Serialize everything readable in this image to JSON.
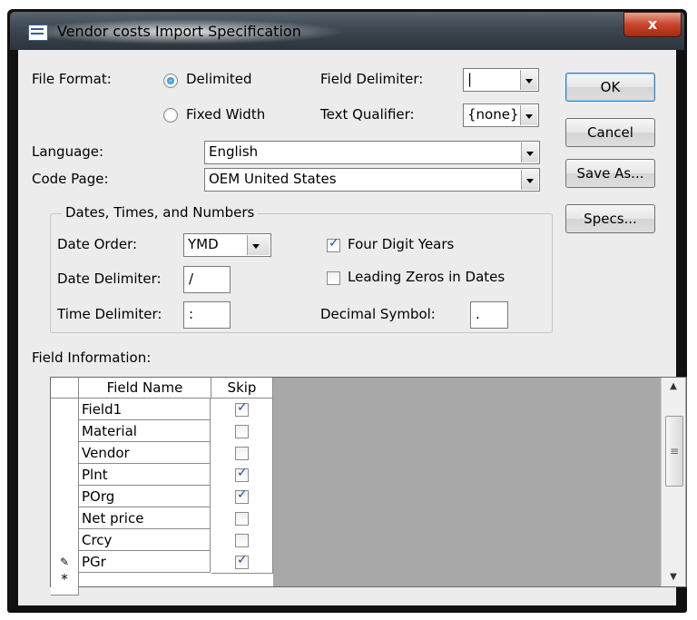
{
  "window": {
    "title": "Vendor costs Import Specification",
    "close_label": "x"
  },
  "file_format": {
    "label": "File Format:",
    "delimited_label": "Delimited",
    "fixed_label": "Fixed Width",
    "selected": "Delimited"
  },
  "field_delimiter": {
    "label": "Field Delimiter:",
    "value": "|"
  },
  "text_qualifier": {
    "label": "Text Qualifier:",
    "value": "{none}"
  },
  "language": {
    "label": "Language:",
    "value": "English"
  },
  "code_page": {
    "label": "Code Page:",
    "value": "OEM United States"
  },
  "dates_group": {
    "title": "Dates, Times, and Numbers",
    "date_order": {
      "label": "Date Order:",
      "value": "YMD"
    },
    "date_delimiter": {
      "label": "Date Delimiter:",
      "value": "/"
    },
    "time_delimiter": {
      "label": "Time Delimiter:",
      "value": ":"
    },
    "four_digit_years": {
      "label": "Four Digit Years",
      "checked": true
    },
    "leading_zeros": {
      "label": "Leading Zeros in Dates",
      "checked": false
    },
    "decimal_symbol": {
      "label": "Decimal Symbol:",
      "value": "."
    }
  },
  "buttons": {
    "ok": "OK",
    "cancel": "Cancel",
    "save_as": "Save As...",
    "specs": "Specs..."
  },
  "field_info": {
    "label": "Field Information:",
    "columns": [
      "Field Name",
      "Skip"
    ],
    "rows": [
      {
        "name": "Field1",
        "skip": true
      },
      {
        "name": "Material",
        "skip": false
      },
      {
        "name": "Vendor",
        "skip": false
      },
      {
        "name": "Plnt",
        "skip": true
      },
      {
        "name": "POrg",
        "skip": true
      },
      {
        "name": "Net price",
        "skip": false
      },
      {
        "name": "Crcy",
        "skip": false
      },
      {
        "name": "PGr",
        "skip": true
      }
    ],
    "editing_marker": "✎",
    "new_row_marker": "*"
  }
}
